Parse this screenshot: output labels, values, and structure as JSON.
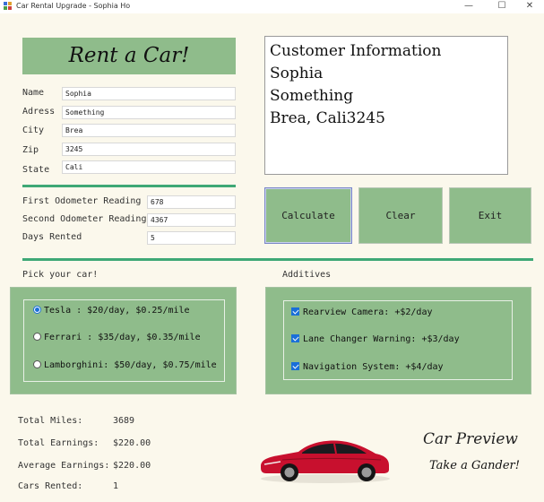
{
  "window": {
    "title": "Car Rental Upgrade - Sophia Ho",
    "minimize": "—",
    "maximize": "☐",
    "close": "✕"
  },
  "banner": "Rent a Car!",
  "customer": {
    "labels": {
      "name": "Name",
      "address": "Adress",
      "city": "City",
      "zip": "Zip",
      "state": "State"
    },
    "values": {
      "name": "Sophia",
      "address": "Something",
      "city": "Brea",
      "zip": "3245",
      "state": "Cali"
    }
  },
  "info_box": {
    "heading": "Customer Information",
    "line1": "Sophia",
    "line2": "Something",
    "line3": "Brea, Cali3245"
  },
  "odometer": {
    "labels": {
      "first": "First Odometer Reading",
      "second": "Second Odometer Reading",
      "days": "Days Rented"
    },
    "values": {
      "first": "678",
      "second": "4367",
      "days": "5"
    }
  },
  "buttons": {
    "calculate": "Calculate",
    "clear": "Clear",
    "exit": "Exit"
  },
  "car_group": {
    "label": "Pick your car!",
    "options": [
      {
        "label": "Tesla :  $20/day, $0.25/mile",
        "checked": true
      },
      {
        "label": "Ferrari : $35/day, $0.35/mile",
        "checked": false
      },
      {
        "label": "Lamborghini: $50/day, $0.75/mile",
        "checked": false
      }
    ]
  },
  "additives": {
    "label": "Additives",
    "options": [
      {
        "label": "Rearview Camera: +$2/day",
        "checked": true
      },
      {
        "label": "Lane Changer Warning: +$3/day",
        "checked": true
      },
      {
        "label": "Navigation System: +$4/day",
        "checked": true
      }
    ]
  },
  "summary": {
    "total_miles_label": "Total Miles:",
    "total_miles": "3689",
    "total_earnings_label": "Total Earnings:",
    "total_earnings": "$220.00",
    "avg_earnings_label": "Average Earnings:",
    "avg_earnings": "$220.00",
    "cars_rented_label": "Cars Rented:",
    "cars_rented": "1"
  },
  "preview": {
    "title": "Car Preview",
    "subtitle": "Take a Gander!"
  },
  "colors": {
    "panel_green": "#8fbc8b",
    "divider_green": "#3ea876",
    "background": "#fbf8ec",
    "car_red": "#c8102e"
  }
}
